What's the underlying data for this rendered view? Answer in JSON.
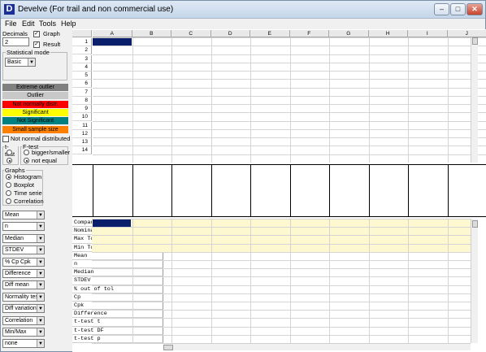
{
  "window": {
    "title": "Develve (For trail and non commercial use)",
    "icon_letter": "D",
    "buttons": [
      "–",
      "□",
      "✕"
    ]
  },
  "menu": [
    "File",
    "Edit",
    "Tools",
    "Help"
  ],
  "left": {
    "decimals_label": "Decimals",
    "decimals_value": "2",
    "graph_label": "Graph",
    "result_label": "Result",
    "stat_mode_label": "Statistical mode",
    "stat_mode_value": "Basic",
    "legend": [
      {
        "label": "Extreme outlier",
        "bg": "#808080",
        "fg": "#000000"
      },
      {
        "label": "Outlier",
        "bg": "#c8c8c8",
        "fg": "#000000"
      },
      {
        "label": "Not normally distr.",
        "bg": "#ff0000",
        "fg": "#000000"
      },
      {
        "label": "Significant",
        "bg": "#ffff00",
        "fg": "#000000"
      },
      {
        "label": "Not Significant",
        "bg": "#008080",
        "fg": "#000000"
      },
      {
        "label": "Small sample size",
        "bg": "#ff8000",
        "fg": "#000000"
      }
    ],
    "not_normal_label": "Not normal distributed",
    "ttest_label": "t-test",
    "ftest_label": "F-test",
    "ftest_options": [
      "bigger/smaller",
      "not equal"
    ],
    "graphs_label": "Graphs",
    "graph_options": [
      "Histogram",
      "Boxplot",
      "Time serie",
      "Correlation"
    ],
    "dropdowns": [
      "Mean",
      "n",
      "Median",
      "STDEV",
      "% Cp Cpk",
      "Difference",
      "Diff mean",
      "Normality test",
      "Diff variation",
      "Correlation",
      "Min/Max",
      "none"
    ]
  },
  "grid": {
    "columns": [
      "A",
      "B",
      "C",
      "D",
      "E",
      "F",
      "G",
      "H",
      "I",
      "J"
    ],
    "rows": [
      "1",
      "2",
      "3",
      "4",
      "5",
      "6",
      "7",
      "8",
      "9",
      "10",
      "11",
      "12",
      "13",
      "14"
    ]
  },
  "results": {
    "rows": [
      "Compare with",
      "Nominal",
      "Max Tol.",
      "Min Tol.",
      "Mean",
      "n",
      "Median",
      "STDEV",
      "% out of tol",
      "Cp",
      "Cpk",
      "Difference",
      "t-test t",
      "t-test DF",
      "t-test p"
    ]
  }
}
